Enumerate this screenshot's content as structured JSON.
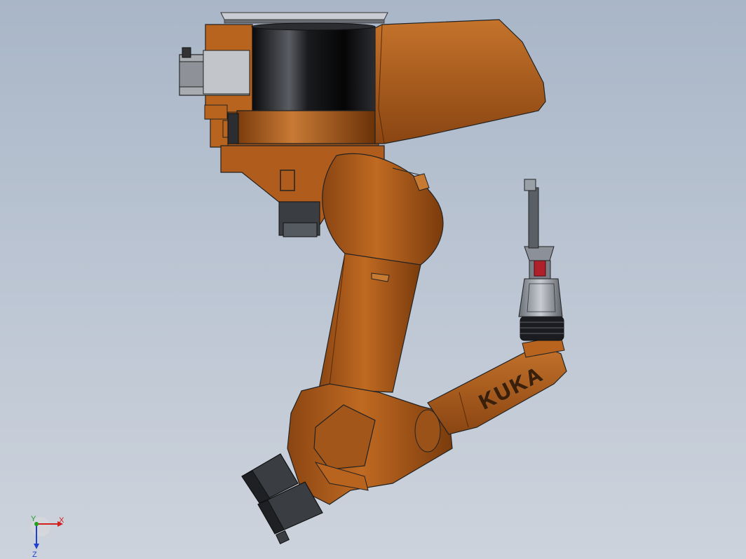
{
  "viewport": {
    "background_top": "#a9b6c7",
    "background_bottom": "#cdd3dc"
  },
  "model": {
    "brand_logo": "KUKA",
    "body_color": "#b8641f",
    "body_shadow": "#7a3e0e",
    "motor_color": "#3a3d42",
    "tool_color": "#9aa0a8",
    "accent_red": "#b0202a"
  },
  "triad": {
    "x_label": "X",
    "y_label": "Y",
    "z_label": "Z",
    "x_color": "#d02020",
    "y_color": "#20a020",
    "z_color": "#2040d0"
  }
}
